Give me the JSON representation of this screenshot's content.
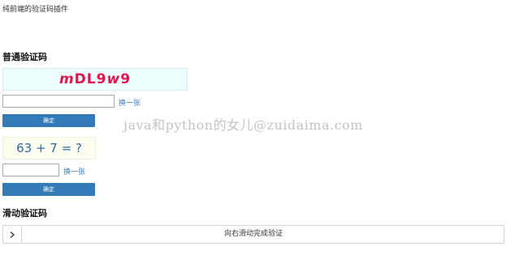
{
  "page": {
    "subtitle": "纯前端的验证码插件",
    "watermark": "java和python的女儿@zuidaima.com"
  },
  "normal_captcha": {
    "heading": "普通验证码",
    "chars": [
      {
        "text": "m",
        "color": "#e0174a",
        "italic": true
      },
      {
        "text": "D",
        "color": "#e0174a",
        "italic": false
      },
      {
        "text": "L",
        "color": "#e0174a",
        "italic": false
      },
      {
        "text": "9",
        "color": "#e0174a",
        "italic": false
      },
      {
        "text": "w",
        "color": "#e0174a",
        "italic": true
      },
      {
        "text": "9",
        "color": "#e0174a",
        "italic": false
      }
    ],
    "input_value": "",
    "refresh_label": "换一张",
    "confirm_label": "确定"
  },
  "math_captcha": {
    "expression": "63 + 7 = ?",
    "input_value": "",
    "refresh_label": "换一张",
    "confirm_label": "确定"
  },
  "slide_captcha": {
    "heading": "滑动验证码",
    "handle_icon": "chevron-right-icon",
    "hint": "向右滑动完成验证"
  },
  "colors": {
    "accent": "#337ab7",
    "link": "#3b7bbf",
    "captcha_bg": "#eefeff",
    "math_bg": "#fefef0"
  }
}
